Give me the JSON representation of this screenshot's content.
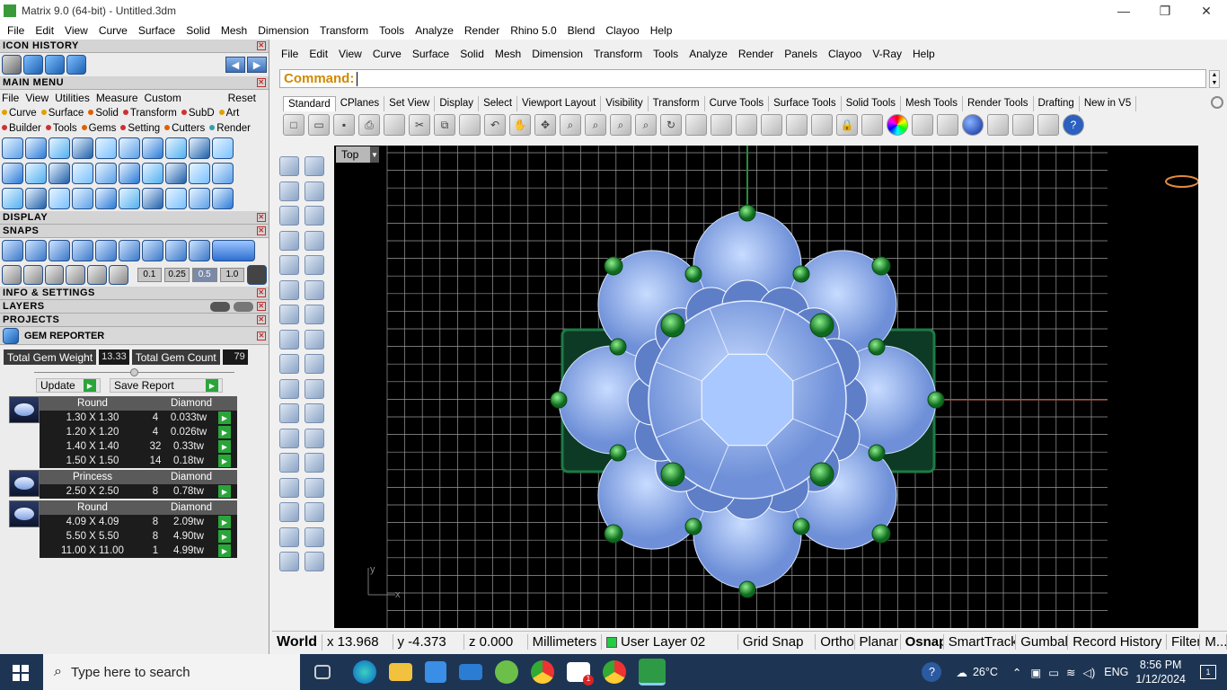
{
  "window": {
    "title": "Matrix 9.0 (64-bit) - Untitled.3dm",
    "controls": [
      "—",
      "❐",
      "✕"
    ]
  },
  "menubar": [
    "File",
    "Edit",
    "View",
    "Curve",
    "Surface",
    "Solid",
    "Mesh",
    "Dimension",
    "Transform",
    "Tools",
    "Analyze",
    "Render",
    "Rhino 5.0",
    "Blend",
    "Clayoo",
    "Help"
  ],
  "left_panel": {
    "icon_history": "ICON HISTORY",
    "main_menu": "MAIN MENU",
    "main_menu_items": [
      "File",
      "View",
      "Utilities",
      "Measure",
      "Custom"
    ],
    "reset": "Reset",
    "categories_row1": [
      {
        "label": "Curve",
        "color": "#e0a000"
      },
      {
        "label": "Surface",
        "color": "#e0a000"
      },
      {
        "label": "Solid",
        "color": "#e06000"
      },
      {
        "label": "Transform",
        "color": "#d03030"
      },
      {
        "label": "SubD",
        "color": "#d03030"
      },
      {
        "label": "Art",
        "color": "#e0a000"
      }
    ],
    "categories_row2": [
      {
        "label": "Builder",
        "color": "#d03030"
      },
      {
        "label": "Tools",
        "color": "#d03030"
      },
      {
        "label": "Gems",
        "color": "#e06000"
      },
      {
        "label": "Setting",
        "color": "#d03030"
      },
      {
        "label": "Cutters",
        "color": "#e06000"
      },
      {
        "label": "Render",
        "color": "#30a0b0"
      }
    ],
    "display": "DISPLAY",
    "snaps": "SNAPS",
    "snap_values": [
      "0.1",
      "0.25",
      "0.5",
      "1.0"
    ],
    "info_settings": "INFO & SETTINGS",
    "layers": "LAYERS",
    "projects": "PROJECTS",
    "gem_reporter": {
      "title": "GEM REPORTER",
      "total_weight_label": "Total Gem Weight",
      "total_weight": "13.33",
      "total_count_label": "Total Gem Count",
      "total_count": "79",
      "update": "Update",
      "save_report": "Save Report",
      "groups": [
        {
          "shape": "Round",
          "material": "Diamond",
          "rows": [
            {
              "size": "1.30 X 1.30",
              "count": "4",
              "weight": "0.033tw"
            },
            {
              "size": "1.20 X 1.20",
              "count": "4",
              "weight": "0.026tw"
            },
            {
              "size": "1.40 X 1.40",
              "count": "32",
              "weight": "0.33tw"
            },
            {
              "size": "1.50 X 1.50",
              "count": "14",
              "weight": "0.18tw"
            }
          ]
        },
        {
          "shape": "Princess",
          "material": "Diamond",
          "rows": [
            {
              "size": "2.50 X 2.50",
              "count": "8",
              "weight": "0.78tw"
            }
          ]
        },
        {
          "shape": "Round",
          "material": "Diamond",
          "rows": [
            {
              "size": "4.09 X 4.09",
              "count": "8",
              "weight": "2.09tw"
            },
            {
              "size": "5.50 X 5.50",
              "count": "8",
              "weight": "4.90tw"
            },
            {
              "size": "11.00 X 11.00",
              "count": "1",
              "weight": "4.99tw"
            }
          ]
        }
      ]
    }
  },
  "rhino": {
    "menu": [
      "File",
      "Edit",
      "View",
      "Curve",
      "Surface",
      "Solid",
      "Mesh",
      "Dimension",
      "Transform",
      "Tools",
      "Analyze",
      "Render",
      "Panels",
      "Clayoo",
      "V-Ray",
      "Help"
    ],
    "command_label": "Command:",
    "tabs": [
      "Standard",
      "CPlanes",
      "Set View",
      "Display",
      "Select",
      "Viewport Layout",
      "Visibility",
      "Transform",
      "Curve Tools",
      "Surface Tools",
      "Solid Tools",
      "Mesh Tools",
      "Render Tools",
      "Drafting",
      "New in V5"
    ],
    "viewport_label": "Top",
    "axis_y": "y",
    "axis_x": "x",
    "status": {
      "cplane": "World",
      "x": "x 13.968",
      "y": "y -4.373",
      "z": "z 0.000",
      "units": "Millimeters",
      "layer": "User Layer 02",
      "layer_color": "#22cc44",
      "toggles": [
        "Grid Snap",
        "Ortho",
        "Planar",
        "Osnap",
        "SmartTrack",
        "Gumball",
        "Record History",
        "Filter",
        "M..."
      ]
    }
  },
  "taskbar": {
    "search_placeholder": "Type here to search",
    "temperature": "26°C",
    "language": "ENG",
    "time": "8:56 PM",
    "date": "1/12/2024",
    "notifications": "1"
  }
}
